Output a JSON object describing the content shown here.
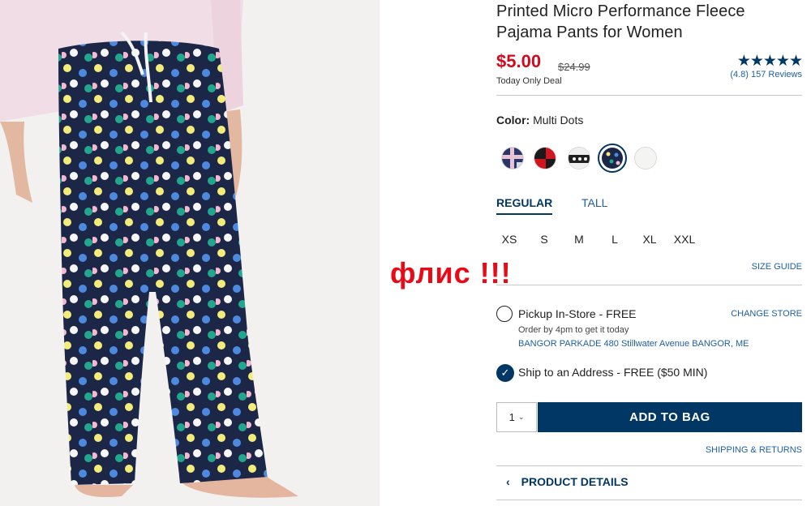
{
  "product": {
    "title_line1": "Printed Micro Performance Fleece",
    "title_line2": "Pajama Pants for Women",
    "price": "$5.00",
    "original_price": "$24.99",
    "deal_label": "Today Only Deal",
    "stars": "★★★★★",
    "rating": 4.8,
    "reviews_text": "(4.8) 157 Reviews"
  },
  "color": {
    "label": "Color:",
    "selected": "Multi Dots",
    "swatches": [
      "plaid-navy",
      "buffalo-check-red",
      "fair-isle-black",
      "multi-dots-navy",
      "solid-white"
    ],
    "selected_index": 3
  },
  "fit_tabs": [
    "REGULAR",
    "TALL"
  ],
  "selected_fit": "REGULAR",
  "sizes": [
    "XS",
    "S",
    "M",
    "L",
    "XL",
    "XXL"
  ],
  "size_guide": "SIZE GUIDE",
  "pickup": {
    "label": "Pickup In-Store - FREE",
    "change_store": "CHANGE STORE",
    "order_by": "Order by 4pm to get it today",
    "store_address": "BANGOR PARKADE 480 Stillwater Avenue  BANGOR, ME",
    "selected": false
  },
  "ship": {
    "label": "Ship to an Address - FREE ($50 MIN)",
    "selected": true
  },
  "quantity": "1",
  "add_to_bag": "ADD TO BAG",
  "shipping_returns": "SHIPPING & RETURNS",
  "product_details": "PRODUCT DETAILS",
  "annotation": "флис !!!",
  "colors": {
    "brand_navy": "#003764",
    "sale_red": "#d10b1e",
    "link_blue": "#1f5fa0",
    "annotation_red": "#e80b17"
  }
}
